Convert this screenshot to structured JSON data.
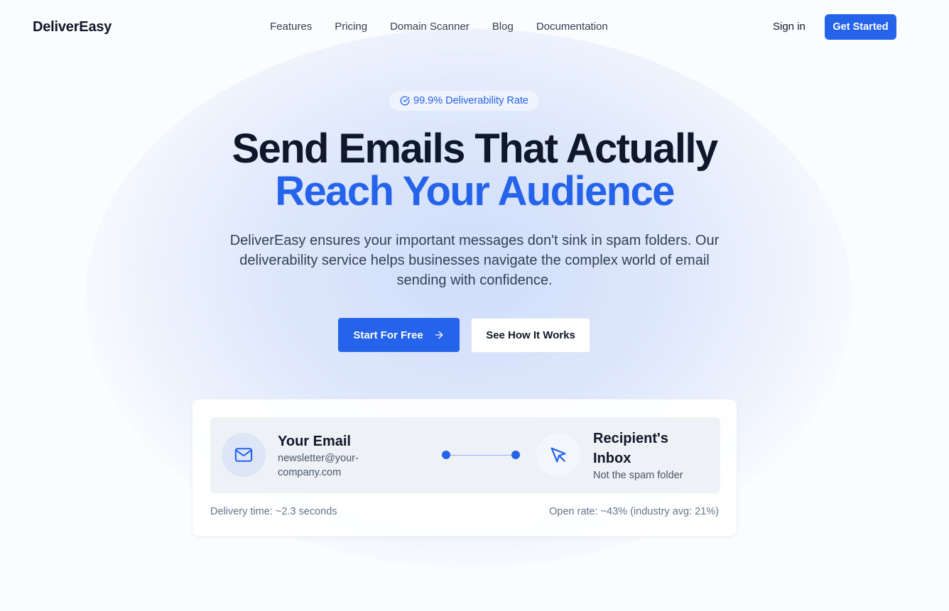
{
  "brand": {
    "name": "DeliverEasy",
    "accent": "#2563eb"
  },
  "nav": {
    "links": [
      "Features",
      "Pricing",
      "Domain Scanner",
      "Blog",
      "Documentation"
    ],
    "sign_in": "Sign in",
    "cta": "Get Started"
  },
  "hero": {
    "badge": {
      "icon": "check-circle-icon",
      "text": "99.9% Deliverability Rate"
    },
    "title_line1": "Send Emails That Actually",
    "title_line2": "Reach Your Audience",
    "subtitle": "DeliverEasy ensures your important messages don't sink in spam folders. Our deliverability service helps businesses navigate the complex world of email sending with confidence.",
    "primary_button": "Start For Free",
    "secondary_button": "See How It Works"
  },
  "flow_card": {
    "from": {
      "icon": "mail-icon",
      "title": "Your Email",
      "detail": "newsletter@your-company.com"
    },
    "to": {
      "icon": "cursor-icon",
      "title": "Recipient's Inbox",
      "detail": "Not the spam folder"
    },
    "delivery_time": "Delivery time: ~2.3 seconds",
    "open_rate": "Open rate: ~43% (industry avg: 21%)"
  }
}
